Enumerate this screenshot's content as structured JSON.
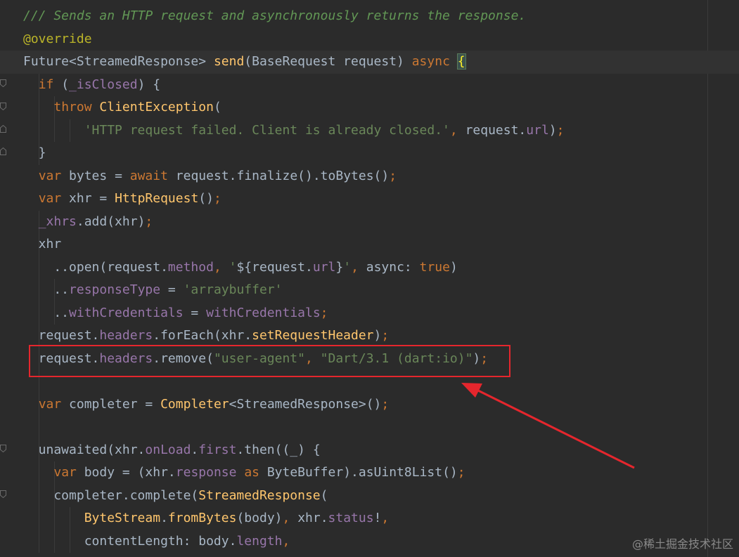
{
  "colors": {
    "background": "#2b2b2b",
    "doc_comment": "#629755",
    "annotation": "#bbb529",
    "keyword": "#cc7832",
    "string": "#6a8759",
    "function": "#ffc66d",
    "field": "#9876aa",
    "plain": "#a9b7c6",
    "highlight_box": "#e5262d"
  },
  "code_lines": [
    [
      {
        "t": "/// Sends an HTTP request and asynchronously returns the response.",
        "k": "doc"
      }
    ],
    [
      {
        "t": "@override",
        "k": "anno"
      }
    ],
    [
      {
        "t": "Future<StreamedResponse> ",
        "k": "plain"
      },
      {
        "t": "send",
        "k": "fn"
      },
      {
        "t": "(BaseRequest request) ",
        "k": "plain"
      },
      {
        "t": "async ",
        "k": "kw"
      },
      {
        "t": "{",
        "k": "brace-hl"
      }
    ],
    [
      {
        "t": "  ",
        "k": "plain"
      },
      {
        "t": "if ",
        "k": "kw"
      },
      {
        "t": "(",
        "k": "plain"
      },
      {
        "t": "_isClosed",
        "k": "field"
      },
      {
        "t": ") {",
        "k": "plain"
      }
    ],
    [
      {
        "t": "    ",
        "k": "plain"
      },
      {
        "t": "throw ",
        "k": "kw"
      },
      {
        "t": "ClientException",
        "k": "fn"
      },
      {
        "t": "(",
        "k": "plain"
      }
    ],
    [
      {
        "t": "        ",
        "k": "plain"
      },
      {
        "t": "'HTTP request failed. Client is already closed.'",
        "k": "str"
      },
      {
        "t": ", ",
        "k": "kw"
      },
      {
        "t": "request.",
        "k": "plain"
      },
      {
        "t": "url",
        "k": "field"
      },
      {
        "t": ")",
        "k": "plain"
      },
      {
        "t": ";",
        "k": "kw"
      }
    ],
    [
      {
        "t": "  }",
        "k": "plain"
      }
    ],
    [
      {
        "t": "  ",
        "k": "plain"
      },
      {
        "t": "var ",
        "k": "kw"
      },
      {
        "t": "bytes = ",
        "k": "plain"
      },
      {
        "t": "await ",
        "k": "kw"
      },
      {
        "t": "request.finalize().toBytes()",
        "k": "plain"
      },
      {
        "t": ";",
        "k": "kw"
      }
    ],
    [
      {
        "t": "  ",
        "k": "plain"
      },
      {
        "t": "var ",
        "k": "kw"
      },
      {
        "t": "xhr = ",
        "k": "plain"
      },
      {
        "t": "HttpRequest",
        "k": "fn"
      },
      {
        "t": "()",
        "k": "plain"
      },
      {
        "t": ";",
        "k": "kw"
      }
    ],
    [
      {
        "t": "  ",
        "k": "plain"
      },
      {
        "t": "_xhrs",
        "k": "field"
      },
      {
        "t": ".add(xhr)",
        "k": "plain"
      },
      {
        "t": ";",
        "k": "kw"
      }
    ],
    [
      {
        "t": "  xhr",
        "k": "plain"
      }
    ],
    [
      {
        "t": "    ..open(request.",
        "k": "plain"
      },
      {
        "t": "method",
        "k": "field"
      },
      {
        "t": ", ",
        "k": "kw"
      },
      {
        "t": "'",
        "k": "str"
      },
      {
        "t": "${",
        "k": "plain"
      },
      {
        "t": "request.",
        "k": "plain"
      },
      {
        "t": "url",
        "k": "field"
      },
      {
        "t": "}",
        "k": "plain"
      },
      {
        "t": "'",
        "k": "str"
      },
      {
        "t": ", ",
        "k": "kw"
      },
      {
        "t": "async: ",
        "k": "plain"
      },
      {
        "t": "true",
        "k": "kw"
      },
      {
        "t": ")",
        "k": "plain"
      }
    ],
    [
      {
        "t": "    ..",
        "k": "plain"
      },
      {
        "t": "responseType",
        "k": "field"
      },
      {
        "t": " = ",
        "k": "plain"
      },
      {
        "t": "'arraybuffer'",
        "k": "str"
      }
    ],
    [
      {
        "t": "    ..",
        "k": "plain"
      },
      {
        "t": "withCredentials",
        "k": "field"
      },
      {
        "t": " = ",
        "k": "plain"
      },
      {
        "t": "withCredentials",
        "k": "field"
      },
      {
        "t": ";",
        "k": "kw"
      }
    ],
    [
      {
        "t": "  request.",
        "k": "plain"
      },
      {
        "t": "headers",
        "k": "field"
      },
      {
        "t": ".forEach(xhr.",
        "k": "plain"
      },
      {
        "t": "setRequestHeader",
        "k": "fn"
      },
      {
        "t": ")",
        "k": "plain"
      },
      {
        "t": ";",
        "k": "kw"
      }
    ],
    [
      {
        "t": "  request.",
        "k": "plain"
      },
      {
        "t": "headers",
        "k": "field"
      },
      {
        "t": ".remove(",
        "k": "plain"
      },
      {
        "t": "\"user-agent\"",
        "k": "str"
      },
      {
        "t": ", ",
        "k": "kw"
      },
      {
        "t": "\"Dart/3.1 (dart:io)\"",
        "k": "str"
      },
      {
        "t": ")",
        "k": "plain"
      },
      {
        "t": ";",
        "k": "kw"
      }
    ],
    [],
    [
      {
        "t": "  ",
        "k": "plain"
      },
      {
        "t": "var ",
        "k": "kw"
      },
      {
        "t": "completer = ",
        "k": "plain"
      },
      {
        "t": "Completer",
        "k": "fn"
      },
      {
        "t": "<StreamedResponse>()",
        "k": "plain"
      },
      {
        "t": ";",
        "k": "kw"
      }
    ],
    [],
    [
      {
        "t": "  unawaited(xhr.",
        "k": "plain"
      },
      {
        "t": "onLoad",
        "k": "field"
      },
      {
        "t": ".",
        "k": "plain"
      },
      {
        "t": "first",
        "k": "field"
      },
      {
        "t": ".then((_) {",
        "k": "plain"
      }
    ],
    [
      {
        "t": "    ",
        "k": "plain"
      },
      {
        "t": "var ",
        "k": "kw"
      },
      {
        "t": "body = (xhr.",
        "k": "plain"
      },
      {
        "t": "response ",
        "k": "field"
      },
      {
        "t": "as ",
        "k": "kw"
      },
      {
        "t": "ByteBuffer).asUint8List()",
        "k": "plain"
      },
      {
        "t": ";",
        "k": "kw"
      }
    ],
    [
      {
        "t": "    completer.complete(",
        "k": "plain"
      },
      {
        "t": "StreamedResponse",
        "k": "fn"
      },
      {
        "t": "(",
        "k": "plain"
      }
    ],
    [
      {
        "t": "        ",
        "k": "plain"
      },
      {
        "t": "ByteStream",
        "k": "fn"
      },
      {
        "t": ".",
        "k": "plain"
      },
      {
        "t": "fromBytes",
        "k": "fn"
      },
      {
        "t": "(body)",
        "k": "plain"
      },
      {
        "t": ", ",
        "k": "kw"
      },
      {
        "t": "xhr.",
        "k": "plain"
      },
      {
        "t": "status",
        "k": "field"
      },
      {
        "t": "!",
        "k": "plain"
      },
      {
        "t": ",",
        "k": "kw"
      }
    ],
    [
      {
        "t": "        contentLength: body.",
        "k": "plain"
      },
      {
        "t": "length",
        "k": "field"
      },
      {
        "t": ",",
        "k": "kw"
      }
    ]
  ],
  "watermark": "@稀土掘金技术社区"
}
